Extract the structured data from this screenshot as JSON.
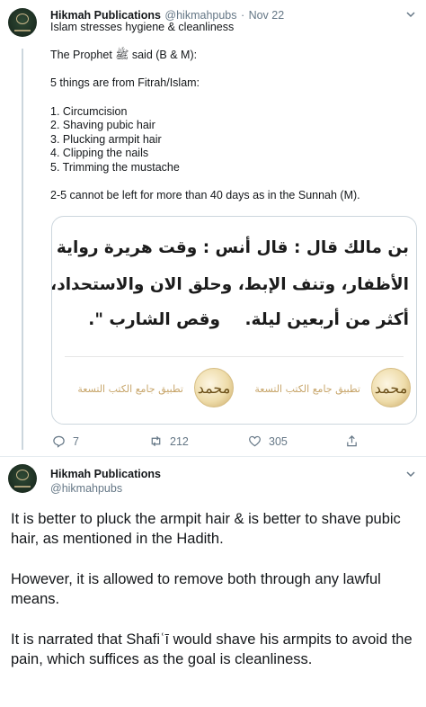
{
  "tweet1": {
    "author_name": "Hikmah Publications",
    "handle": "@hikmahpubs",
    "separator": "·",
    "date": "Nov 22",
    "text_lines": [
      "Islam stresses hygiene & cleanliness",
      "",
      "The Prophet ﷺ said (B & M):",
      "",
      "5 things are from Fitrah/Islam:",
      "",
      "1. Circumcision",
      "2. Shaving pubic hair",
      "3. Plucking armpit hair",
      "4. Clipping the nails",
      "5. Trimming the mustache",
      "",
      "2-5 cannot be left for more than 40 days as in the Sunnah (M)."
    ],
    "image": {
      "arabic_lines": [
        "بن مالك قال : قال أنس : وقت هريرة رواية : \" الفطرة خمس",
        "الأظفار، وتنف الإبط، وحلق الان والاستحداد، ونتف الإبط وت",
        "أكثر من أربعين ليلة.",
        "وقص الشارب \"."
      ],
      "app_label": "تطبيق جامع الكتب التسعة",
      "logo_glyph": "محمد"
    },
    "actions": {
      "reply_count": "7",
      "retweet_count": "212",
      "like_count": "305"
    }
  },
  "tweet2": {
    "author_name": "Hikmah Publications",
    "handle": "@hikmahpubs",
    "text": "It is better to pluck the armpit hair & is better to shave pubic hair, as mentioned in the Hadith.\n\nHowever, it is allowed to remove both through any lawful means.\n\nIt is narrated that Shafiʿī would shave his armpits to avoid the pain, which suffices as the goal is cleanliness."
  },
  "icons": {
    "reply": "reply-icon",
    "retweet": "retweet-icon",
    "like": "like-icon",
    "share": "share-icon",
    "more": "chevron-down-icon"
  },
  "colors": {
    "text": "#14171a",
    "secondary": "#657786",
    "border": "#ccd6dd"
  }
}
